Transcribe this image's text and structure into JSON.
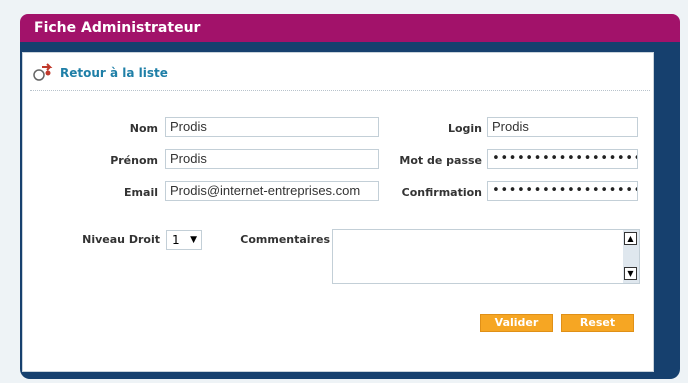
{
  "window": {
    "title": "Fiche Administrateur"
  },
  "back_link": {
    "label": "Retour à la liste",
    "icon": "back-arrow-icon"
  },
  "form": {
    "nom": {
      "label": "Nom",
      "value": "Prodis"
    },
    "prenom": {
      "label": "Prénom",
      "value": "Prodis"
    },
    "email": {
      "label": "Email",
      "value": "Prodis@internet-entreprises.com"
    },
    "login": {
      "label": "Login",
      "value": "Prodis"
    },
    "mot_de_passe": {
      "label": "Mot de passe",
      "value": "••••••••••••••••••"
    },
    "confirmation": {
      "label": "Confirmation",
      "value": "••••••••••••••••••"
    },
    "niveau_droit": {
      "label": "Niveau Droit",
      "value": "1"
    },
    "commentaires": {
      "label": "Commentaires",
      "value": ""
    }
  },
  "buttons": {
    "valider": "Valider",
    "reset": "Reset"
  },
  "colors": {
    "title_bar": "#a2126a",
    "frame": "#16406e",
    "link": "#1f7fa7",
    "button": "#f6a623"
  }
}
